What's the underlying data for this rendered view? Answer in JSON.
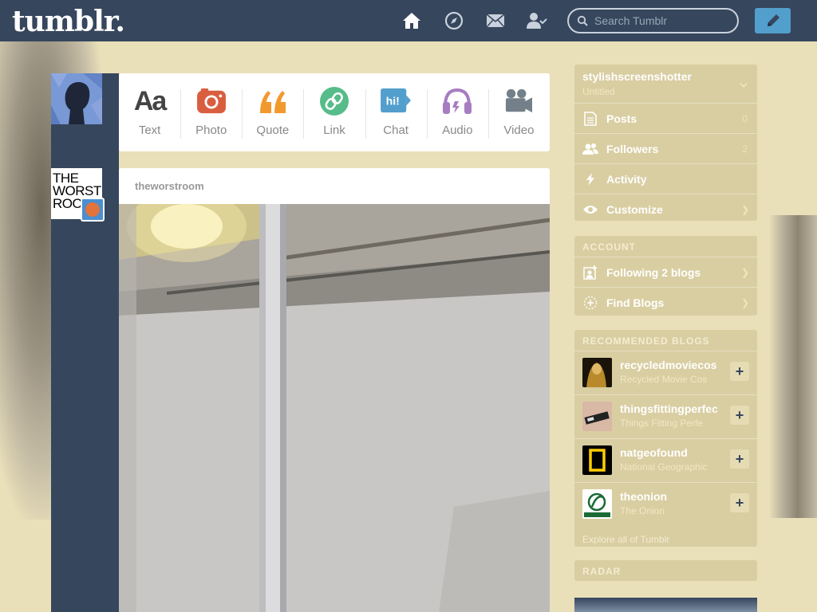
{
  "header": {
    "logo": "tumblr.",
    "search_placeholder": "Search Tumblr"
  },
  "post_types": [
    {
      "label": "Text",
      "icon": "text-icon",
      "color": "#444444"
    },
    {
      "label": "Photo",
      "icon": "camera-icon",
      "color": "#d95e40"
    },
    {
      "label": "Quote",
      "icon": "quote-icon",
      "color": "#f2992e"
    },
    {
      "label": "Link",
      "icon": "link-icon",
      "color": "#56bc8a"
    },
    {
      "label": "Chat",
      "icon": "chat-icon",
      "color": "#529ecc"
    },
    {
      "label": "Audio",
      "icon": "headphones-icon",
      "color": "#a77dc2"
    },
    {
      "label": "Video",
      "icon": "video-camera-icon",
      "color": "#748089"
    }
  ],
  "dashboard": {
    "worst_room_avatar_text": "THE WORST ROO",
    "post_author": "theworstroom"
  },
  "sidebar": {
    "blog": {
      "name": "stylishscreenshotter",
      "subtitle": "Untitled",
      "items": [
        {
          "label": "Posts",
          "value": "0"
        },
        {
          "label": "Followers",
          "value": "2"
        },
        {
          "label": "Activity",
          "value": ""
        },
        {
          "label": "Customize",
          "value": ""
        }
      ]
    },
    "account": {
      "heading": "ACCOUNT",
      "items": [
        {
          "label": "Following 2 blogs"
        },
        {
          "label": "Find Blogs"
        }
      ]
    },
    "recommended": {
      "heading": "RECOMMENDED BLOGS",
      "blogs": [
        {
          "name": "recycledmoviecos",
          "title": "Recycled Movie Cos"
        },
        {
          "name": "thingsfittingperfec",
          "title": "Things Fitting Perfe"
        },
        {
          "name": "natgeofound",
          "title": "National Geographic"
        },
        {
          "name": "theonion",
          "title": "The Onion"
        }
      ],
      "explore_link": "Explore all of Tumblr"
    },
    "radar": {
      "heading": "RADAR"
    }
  }
}
